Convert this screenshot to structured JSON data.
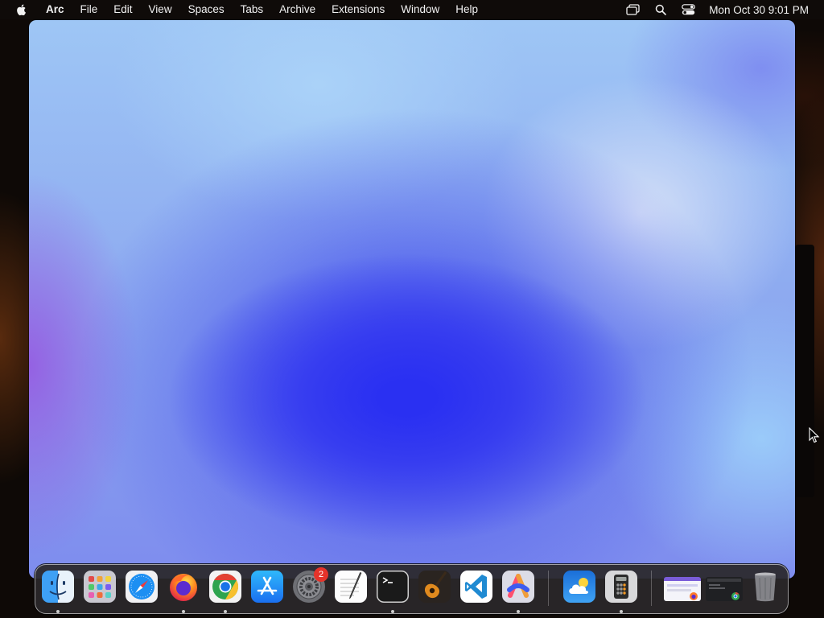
{
  "menubar": {
    "apple_icon": "apple-logo-icon",
    "app_name": "Arc",
    "menus": [
      "File",
      "Edit",
      "View",
      "Spaces",
      "Tabs",
      "Archive",
      "Extensions",
      "Window",
      "Help"
    ],
    "status_icons": [
      "screen-mirroring-icon",
      "spotlight-search-icon",
      "control-center-icon"
    ],
    "clock": "Mon Oct 30  9:01 PM"
  },
  "dock": {
    "apps": [
      {
        "name": "Finder",
        "icon": "finder-icon",
        "running": true
      },
      {
        "name": "Launchpad",
        "icon": "launchpad-icon",
        "running": false
      },
      {
        "name": "Safari",
        "icon": "safari-compass-icon",
        "running": false
      },
      {
        "name": "Firefox",
        "icon": "firefox-icon",
        "running": true
      },
      {
        "name": "Google Chrome",
        "icon": "chrome-icon",
        "running": true
      },
      {
        "name": "App Store",
        "icon": "app-store-icon",
        "running": false
      },
      {
        "name": "System Settings",
        "icon": "gear-icon",
        "running": false,
        "badge": "2"
      },
      {
        "name": "TextEdit",
        "icon": "textedit-icon",
        "running": false
      },
      {
        "name": "Terminal",
        "icon": "terminal-icon",
        "running": true
      },
      {
        "name": "GarageBand",
        "icon": "guitar-icon",
        "running": false
      },
      {
        "name": "Visual Studio Code",
        "icon": "vscode-icon",
        "running": false
      },
      {
        "name": "Arc",
        "icon": "arc-icon",
        "running": true
      },
      {
        "name": "Weather",
        "icon": "weather-cloud-icon",
        "running": false
      },
      {
        "name": "Calculator",
        "icon": "calculator-icon",
        "running": true
      }
    ],
    "minimized": [
      {
        "name": "Firefox window",
        "icon": "minimized-window-thumbnail"
      },
      {
        "name": "Chrome window",
        "icon": "minimized-window-thumbnail"
      }
    ],
    "trash": {
      "name": "Trash",
      "icon": "trash-icon"
    }
  },
  "colors": {
    "menubar_bg": "#0f0b09",
    "dock_bg": "#2a282a",
    "badge_red": "#e5332a",
    "arc_wallpaper_blue": "#2a30f2"
  }
}
